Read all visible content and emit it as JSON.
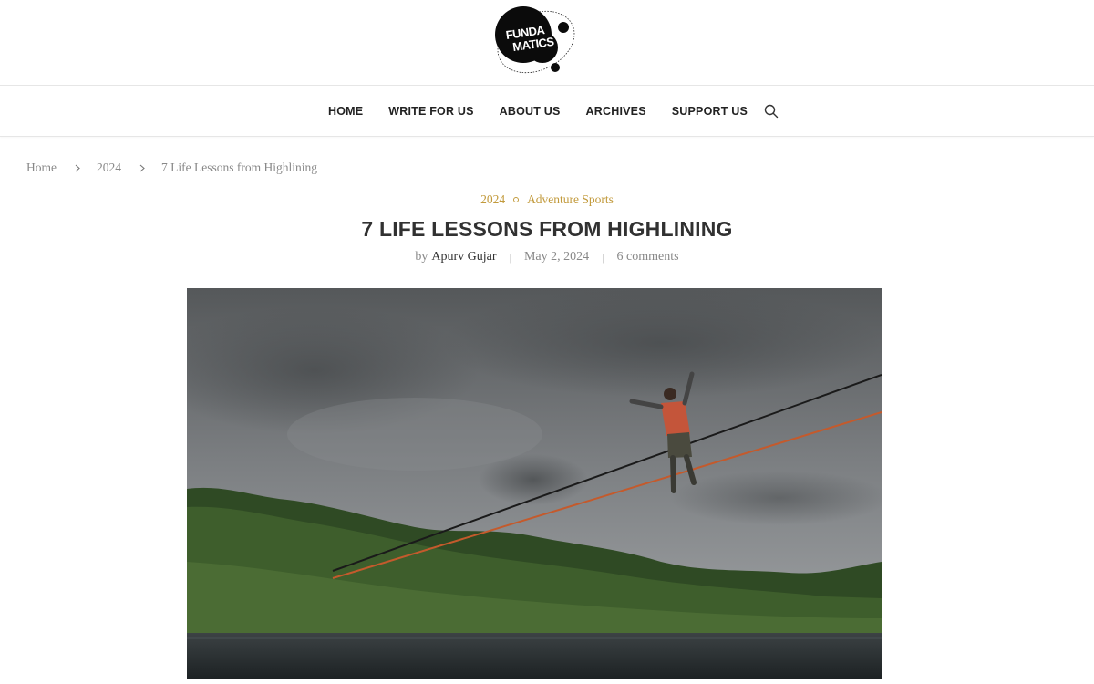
{
  "site": {
    "logo_line1": "FUNDA",
    "logo_line2": "MATICS",
    "logo_icon": "planet-orbit-logo"
  },
  "nav": {
    "items": [
      {
        "label": "HOME"
      },
      {
        "label": "WRITE FOR US"
      },
      {
        "label": "ABOUT US"
      },
      {
        "label": "ARCHIVES"
      },
      {
        "label": "SUPPORT US"
      }
    ],
    "search_icon": "search-icon"
  },
  "breadcrumb": {
    "items": [
      {
        "label": "Home"
      },
      {
        "label": "2024"
      },
      {
        "label": "7 Life Lessons from Highlining"
      }
    ],
    "separator_icon": "chevron-right-icon"
  },
  "post": {
    "categories": [
      {
        "label": "2024"
      },
      {
        "label": "Adventure Sports"
      }
    ],
    "title": "7 LIFE LESSONS FROM HIGHLINING",
    "by_prefix": "by",
    "author": "Apurv Gujar",
    "date": "May 2, 2024",
    "comments": "6 comments"
  },
  "colors": {
    "accent": "#c29a3c",
    "text": "#313131",
    "muted": "#888888"
  }
}
